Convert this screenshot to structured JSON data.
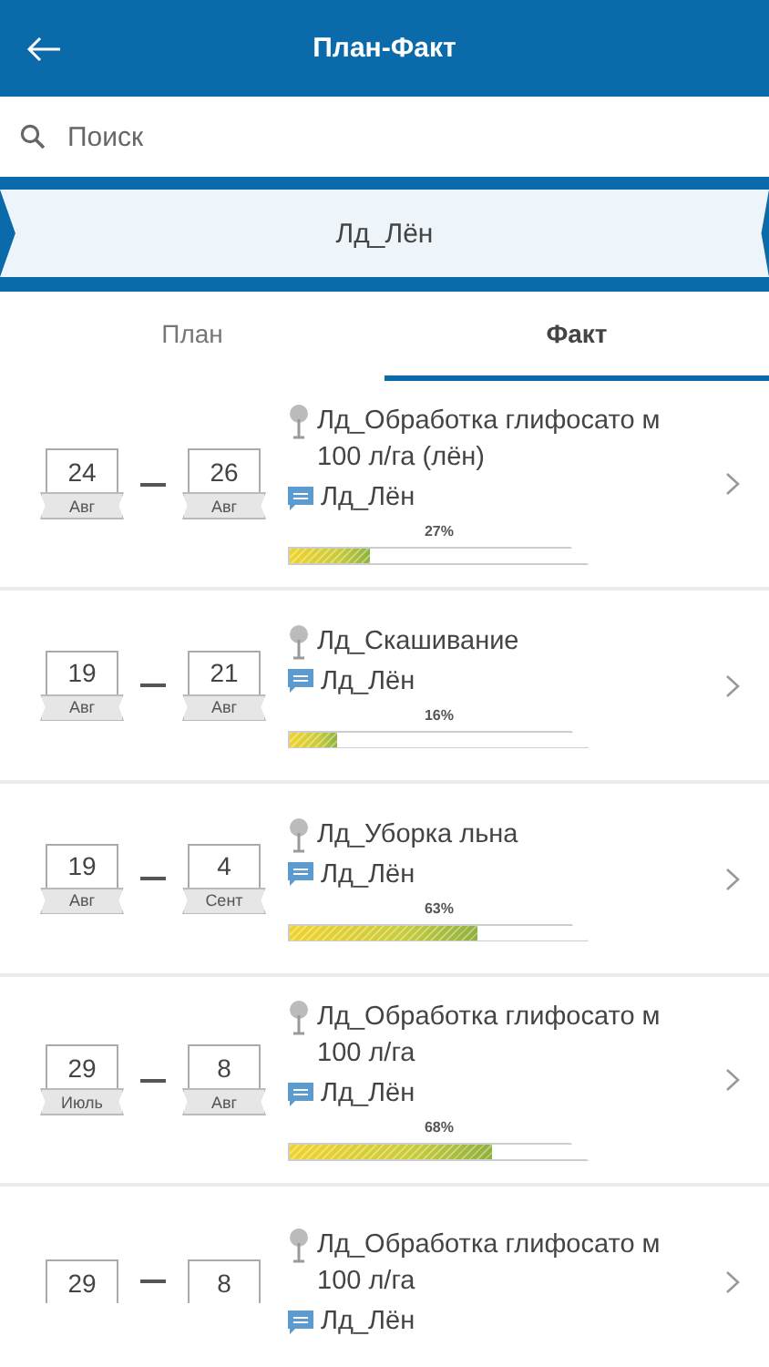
{
  "header": {
    "title": "План-Факт"
  },
  "search": {
    "placeholder": "Поиск"
  },
  "banner": {
    "label": "Лд_Лён"
  },
  "tabs": [
    {
      "label": "План",
      "selected": false
    },
    {
      "label": "Факт",
      "selected": true
    }
  ],
  "tasks": [
    {
      "start": {
        "day": "24",
        "month": "Авг"
      },
      "end": {
        "day": "26",
        "month": "Авг"
      },
      "title": "Лд_Обработка глифосато м 100 л/га (лён)",
      "field": "Лд_Лён",
      "percent": "27%",
      "level": 0.27
    },
    {
      "start": {
        "day": "19",
        "month": "Авг"
      },
      "end": {
        "day": "21",
        "month": "Авг"
      },
      "title": "Лд_Скашивание",
      "field": "Лд_Лён",
      "percent": "16%",
      "level": 0.16
    },
    {
      "start": {
        "day": "19",
        "month": "Авг"
      },
      "end": {
        "day": "4",
        "month": "Сент"
      },
      "title": "Лд_Уборка льна",
      "field": "Лд_Лён",
      "percent": "63%",
      "level": 0.63
    },
    {
      "start": {
        "day": "29",
        "month": "Июль"
      },
      "end": {
        "day": "8",
        "month": "Авг"
      },
      "title": "Лд_Обработка глифосато м 100 л/га",
      "field": "Лд_Лён",
      "percent": "68%",
      "level": 0.68
    },
    {
      "start": {
        "day": "29"
      },
      "end": {
        "day": "8"
      },
      "title": "Лд_Обработка глифосато м 100 л/га",
      "field": "Лд_Лён"
    }
  ]
}
